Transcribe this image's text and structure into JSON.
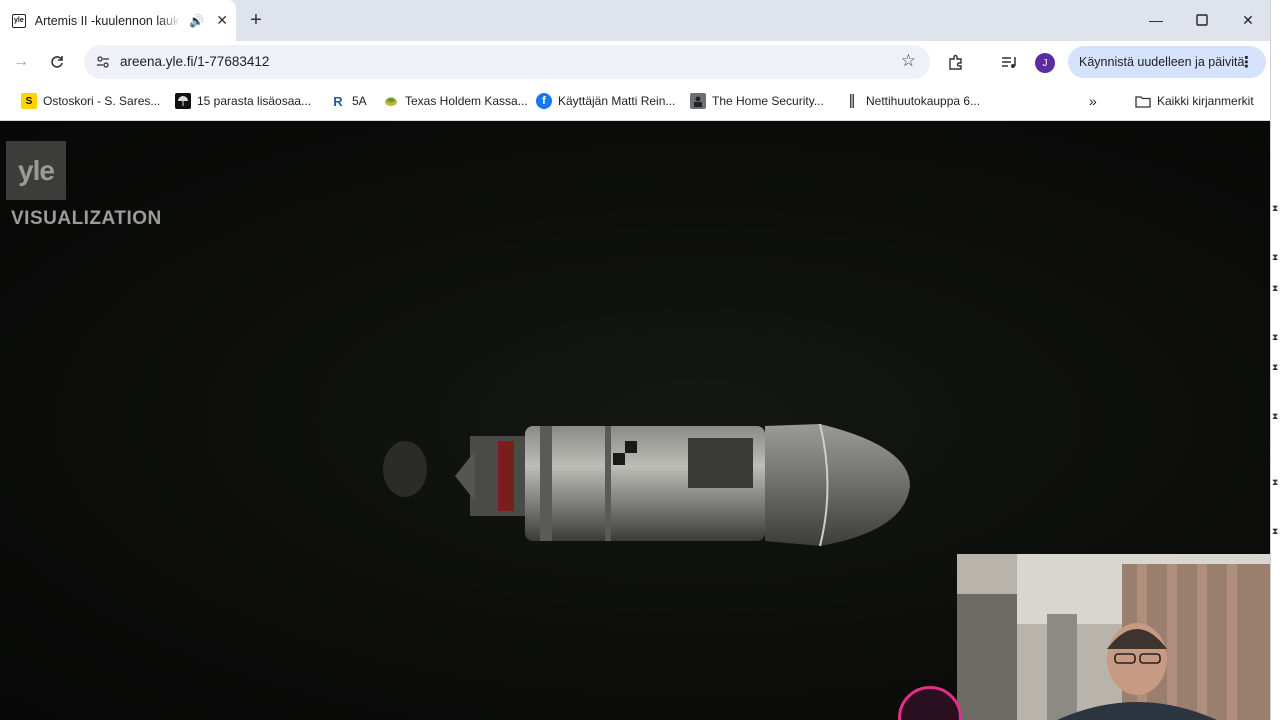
{
  "tab": {
    "favicon": "yle",
    "title": "Artemis II -kuulennon laukaisu",
    "audio_icon": "speaker-icon",
    "close_icon": "close-icon"
  },
  "toolbar": {
    "url": "areena.yle.fi/1-77683412",
    "avatar_initial": "J",
    "update_label": "Käynnistä uudelleen ja päivitä"
  },
  "bookmarks": {
    "items": [
      {
        "icon_text": "S",
        "label": "Ostoskori - S. Sares..."
      },
      {
        "icon_text": "",
        "label": "15 parasta lisäosaa..."
      },
      {
        "icon_text": "R",
        "label": "5A"
      },
      {
        "icon_text": "",
        "label": "Texas Holdem Kassa..."
      },
      {
        "icon_text": "f",
        "label": "Käyttäjän Matti Rein..."
      },
      {
        "icon_text": "",
        "label": "The Home Security..."
      },
      {
        "icon_text": "",
        "label": "Nettihuutokauppa 6..."
      }
    ],
    "more_label": "»",
    "all_bookmarks_label": "Kaikki kirjanmerkit"
  },
  "player": {
    "logo_text": "yle",
    "overlay_label": "VISUALIZATION"
  },
  "colors": {
    "tabstrip_bg": "#dfe3eb",
    "update_button_bg": "#d4e2fc",
    "avatar_bg": "#5b2ca0",
    "badge_ring": "#e0308a"
  }
}
